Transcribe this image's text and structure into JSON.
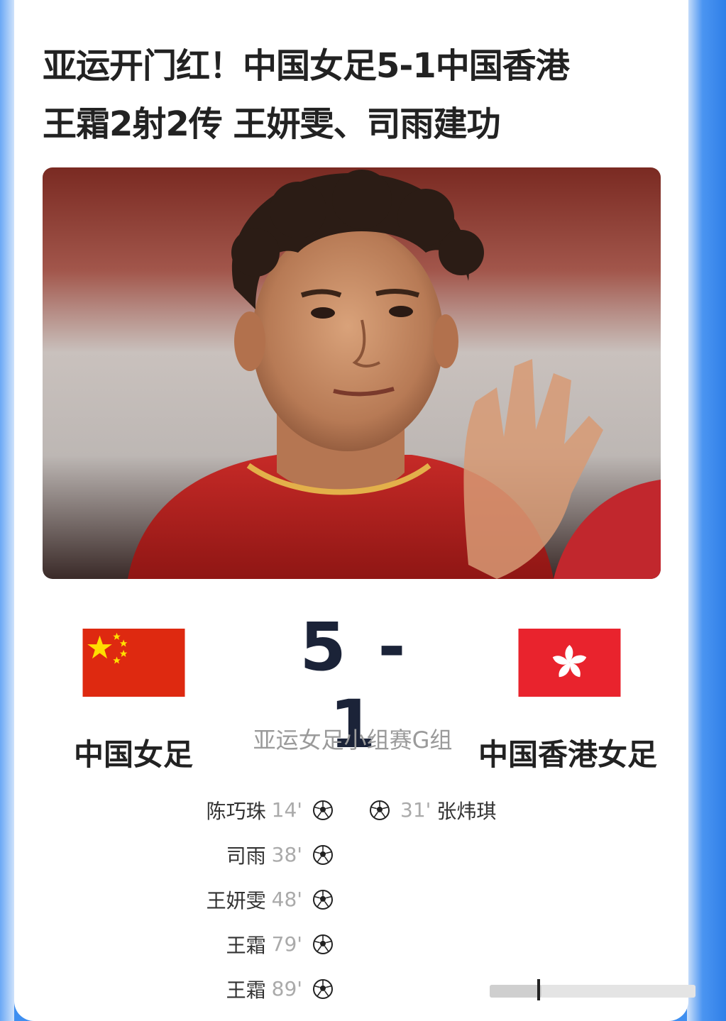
{
  "article": {
    "title_line1": "亚运开门红！中国女足5-1中国香港",
    "title_line2": "王霜2射2传 王妍雯、司雨建功"
  },
  "match": {
    "score_text": "5 - 1",
    "home_score": 5,
    "away_score": 1,
    "home_team": "中国女足",
    "away_team": "中国香港女足",
    "competition": "亚运女足小组赛G组",
    "home_goals": [
      {
        "scorer": "陈巧珠",
        "minute": "14'"
      },
      {
        "scorer": "司雨",
        "minute": "38'"
      },
      {
        "scorer": "王妍雯",
        "minute": "48'"
      },
      {
        "scorer": "王霜",
        "minute": "79'"
      },
      {
        "scorer": "王霜",
        "minute": "89'"
      }
    ],
    "away_goals": [
      {
        "scorer": "张炜琪",
        "minute": "31'"
      }
    ]
  },
  "icons": {
    "home_flag": "china-flag-icon",
    "away_flag": "hong-kong-flag-icon",
    "goal": "soccer-ball-icon"
  },
  "colors": {
    "flag_red": "#de2910",
    "star_yellow": "#ffde00",
    "hk_red": "#e9232d",
    "score_navy": "#1b2338",
    "background_blue": "#3f8ff0"
  },
  "progress": {
    "fraction": 0.25
  }
}
